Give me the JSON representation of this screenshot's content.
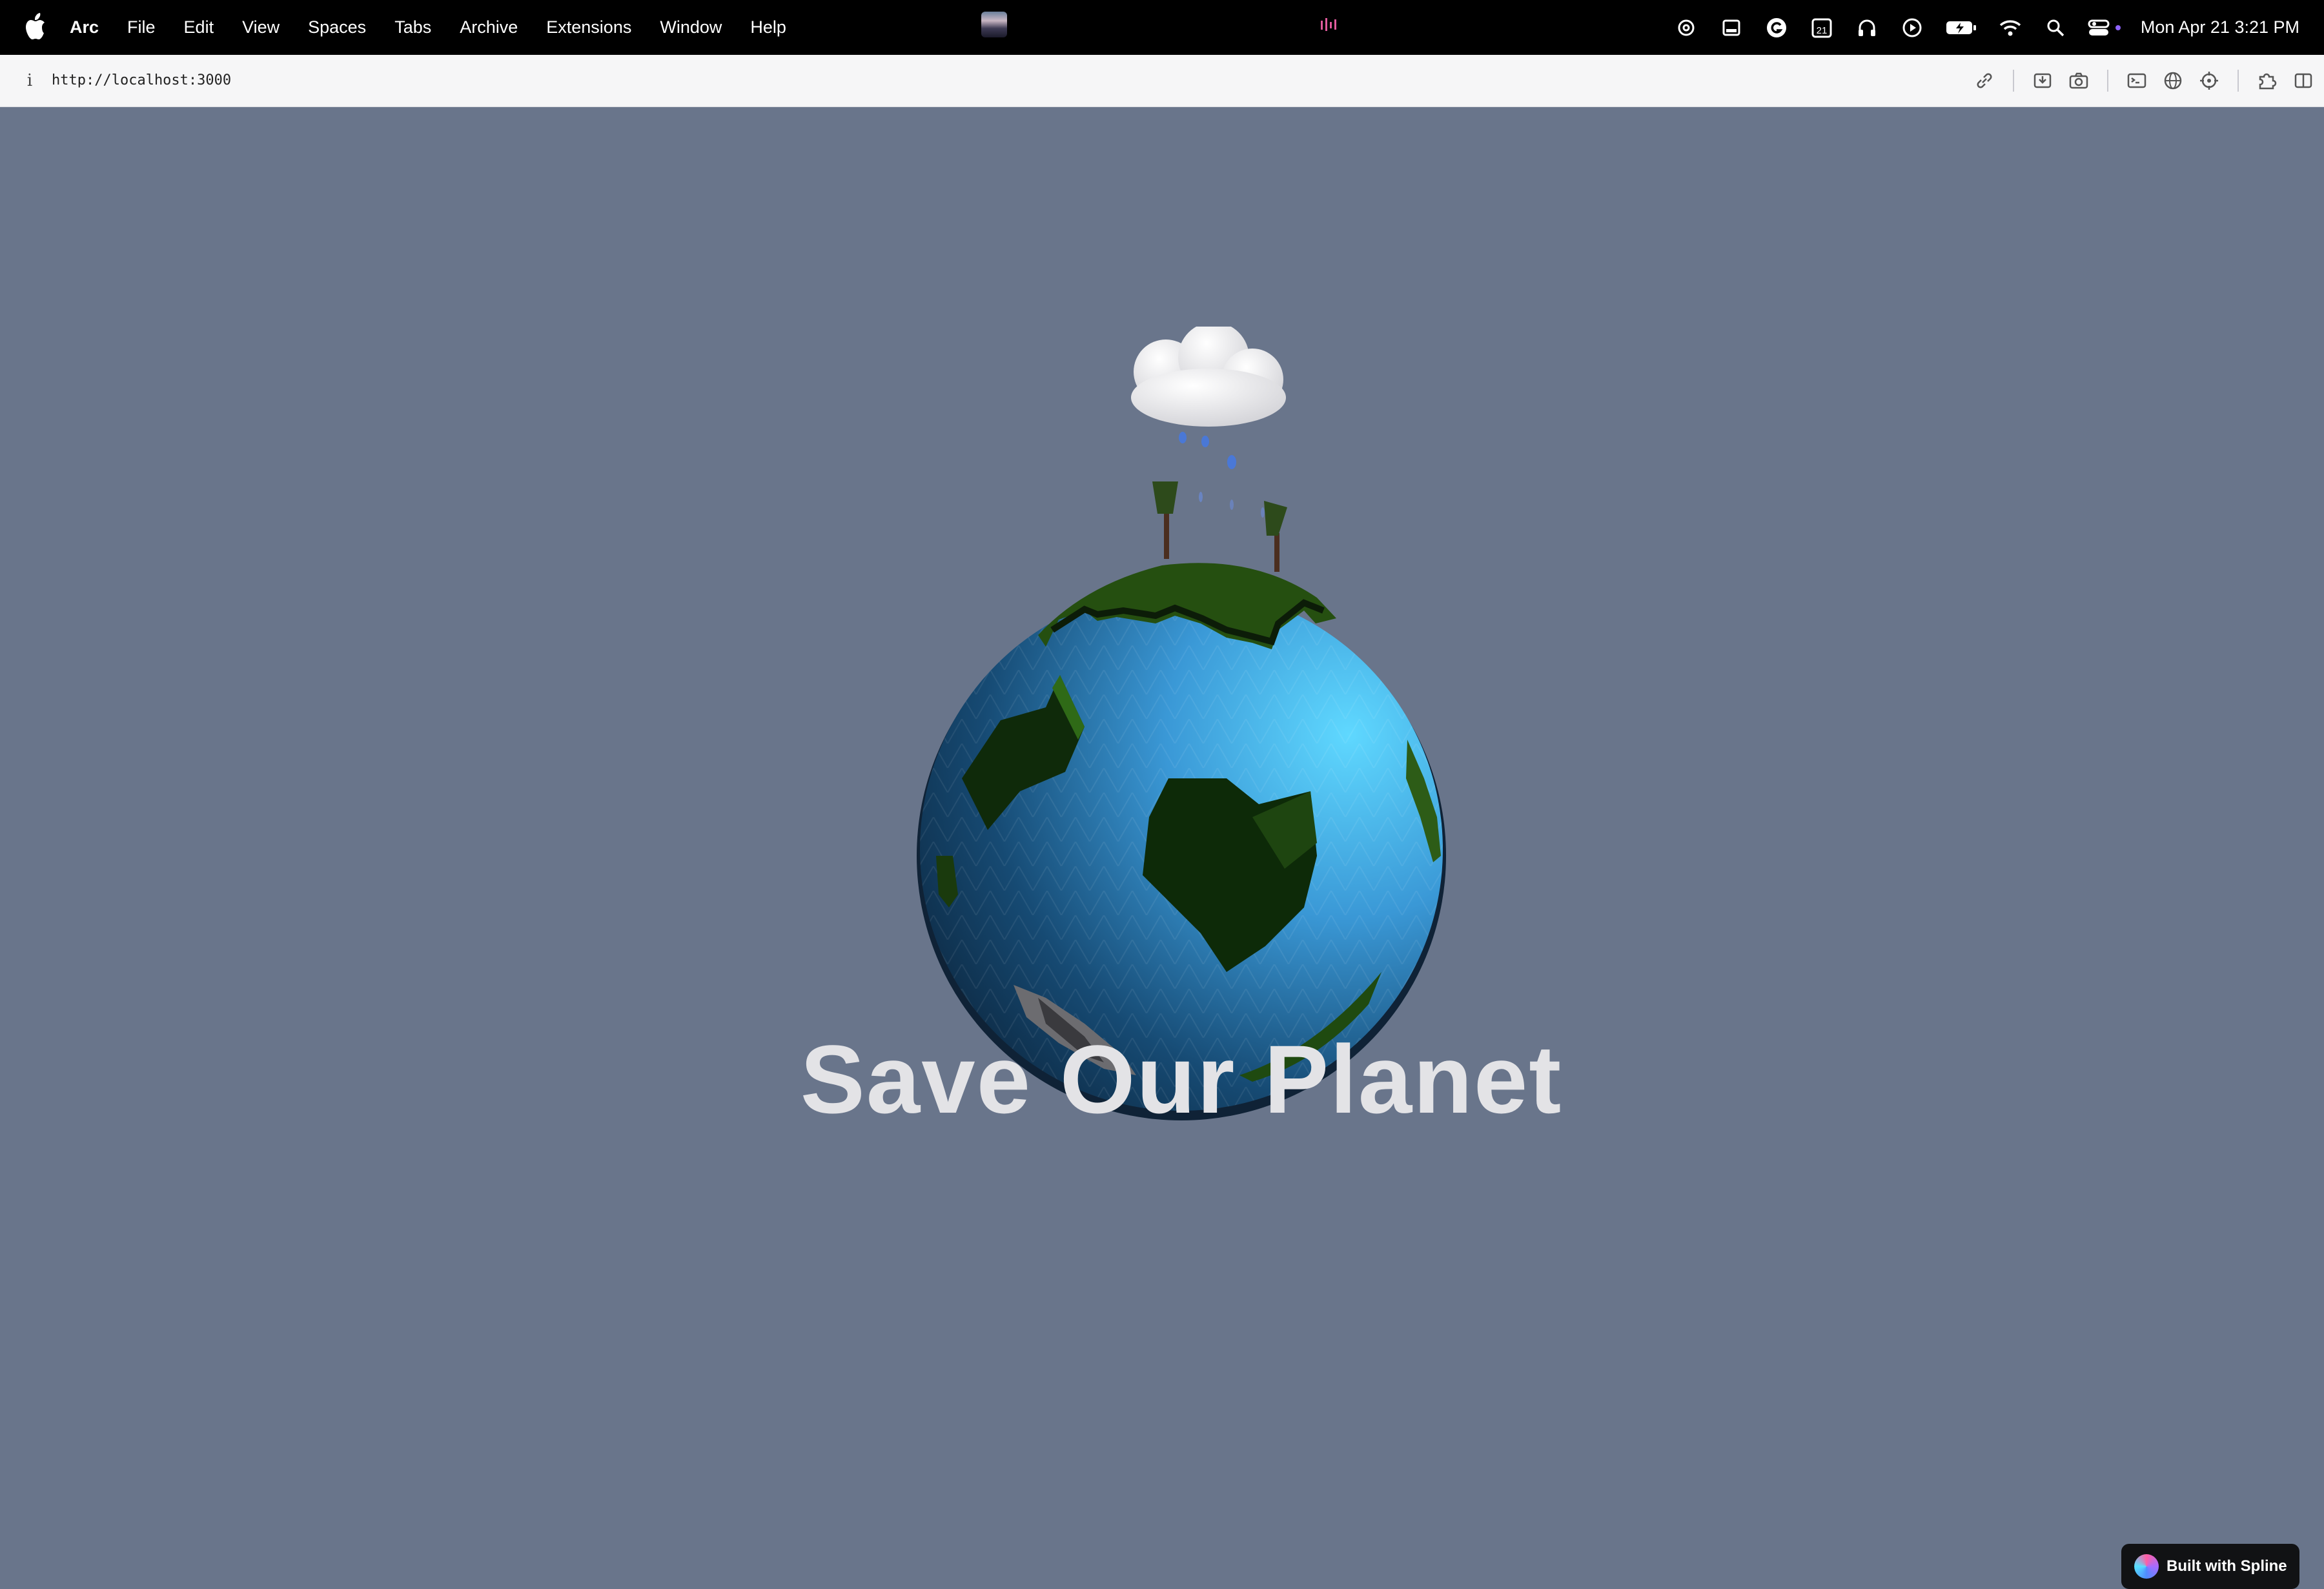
{
  "menubar": {
    "app_name": "Arc",
    "menus": [
      "File",
      "Edit",
      "View",
      "Spaces",
      "Tabs",
      "Archive",
      "Extensions",
      "Window",
      "Help"
    ],
    "status_icons": [
      "openai-icon",
      "screen-icon",
      "grammarly-icon",
      "calendar-icon",
      "headphones-icon",
      "play-icon",
      "battery-icon",
      "wifi-icon",
      "search-icon",
      "control-center-icon"
    ],
    "calendar_day": "21",
    "clock": "Mon Apr 21  3:21 PM"
  },
  "toolbar": {
    "info_glyph": "i",
    "url": "http://localhost:3000",
    "tools": [
      "link-icon",
      "capture-icon",
      "camera-icon",
      "terminal-icon",
      "globe-icon",
      "target-icon",
      "extensions-icon",
      "split-view-icon"
    ]
  },
  "page": {
    "headline": "Save Our Planet",
    "badge_label": "Built with Spline",
    "background_color": "#69758b"
  }
}
